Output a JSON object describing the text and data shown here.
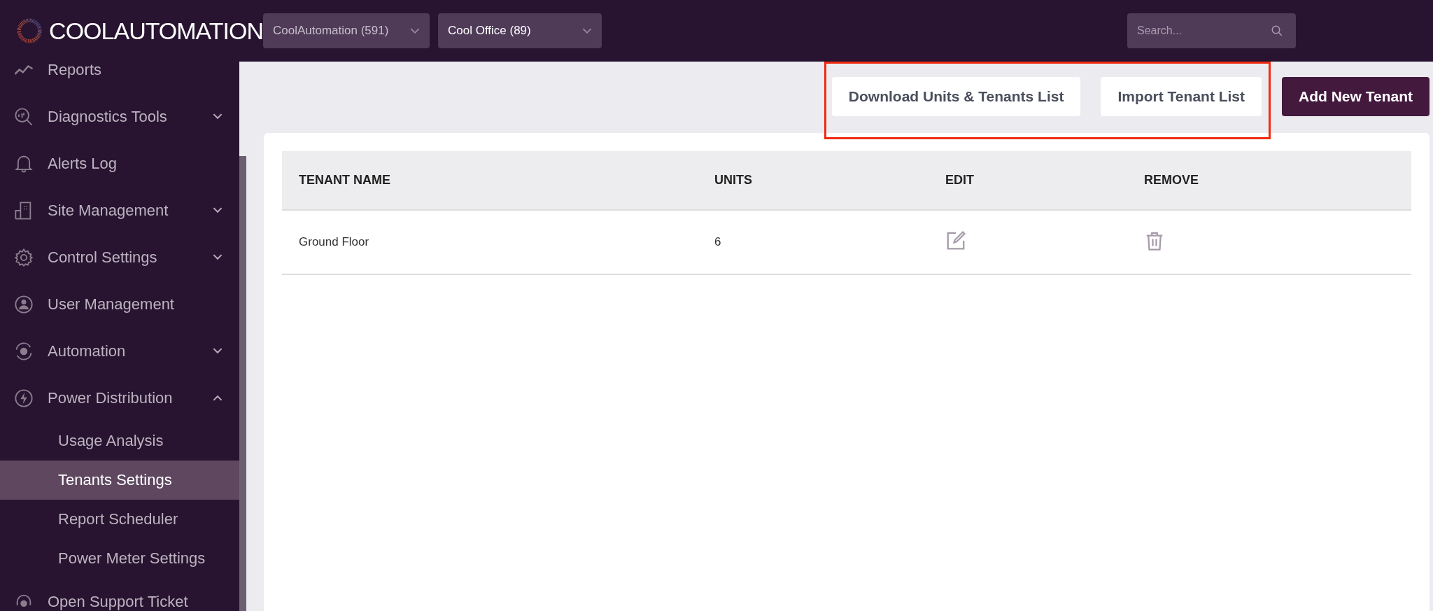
{
  "header": {
    "logo": "**COOL**AUTOMATION",
    "customer_select": "CoolAutomation (591)",
    "site_select": "Cool Office (89)",
    "search": {
      "placeholder": "Search..."
    }
  },
  "sidebar": {
    "items": [
      {
        "label": "Reports",
        "expandable": false
      },
      {
        "label": "Diagnostics Tools",
        "expandable": true,
        "expanded": false
      },
      {
        "label": "Alerts Log",
        "expandable": false
      },
      {
        "label": "Site Management",
        "expandable": true,
        "expanded": false
      },
      {
        "label": "Control Settings",
        "expandable": true,
        "expanded": false
      },
      {
        "label": "User Management",
        "expandable": false
      },
      {
        "label": "Automation",
        "expandable": true,
        "expanded": false
      },
      {
        "label": "Power Distribution",
        "expandable": true,
        "expanded": true,
        "children": [
          {
            "label": "Usage Analysis",
            "selected": false
          },
          {
            "label": "Tenants Settings",
            "selected": true
          },
          {
            "label": "Report Scheduler",
            "selected": false
          },
          {
            "label": "Power Meter Settings",
            "selected": false
          }
        ]
      },
      {
        "label": "Open Support Ticket",
        "expandable": false
      }
    ]
  },
  "toolbar": {
    "buttons": [
      {
        "label": "Download Units & Tenants List",
        "kind": "secondary",
        "highlighted": true
      },
      {
        "label": "Import Tenant List",
        "kind": "secondary",
        "highlighted": true
      },
      {
        "label": "Add New Tenant",
        "kind": "primary",
        "highlighted": false
      }
    ]
  },
  "table": {
    "columns": [
      "TENANT NAME",
      "UNITS",
      "EDIT",
      "REMOVE"
    ],
    "rows": [
      {
        "tenant_name": "Ground Floor",
        "units": "6"
      }
    ]
  }
}
